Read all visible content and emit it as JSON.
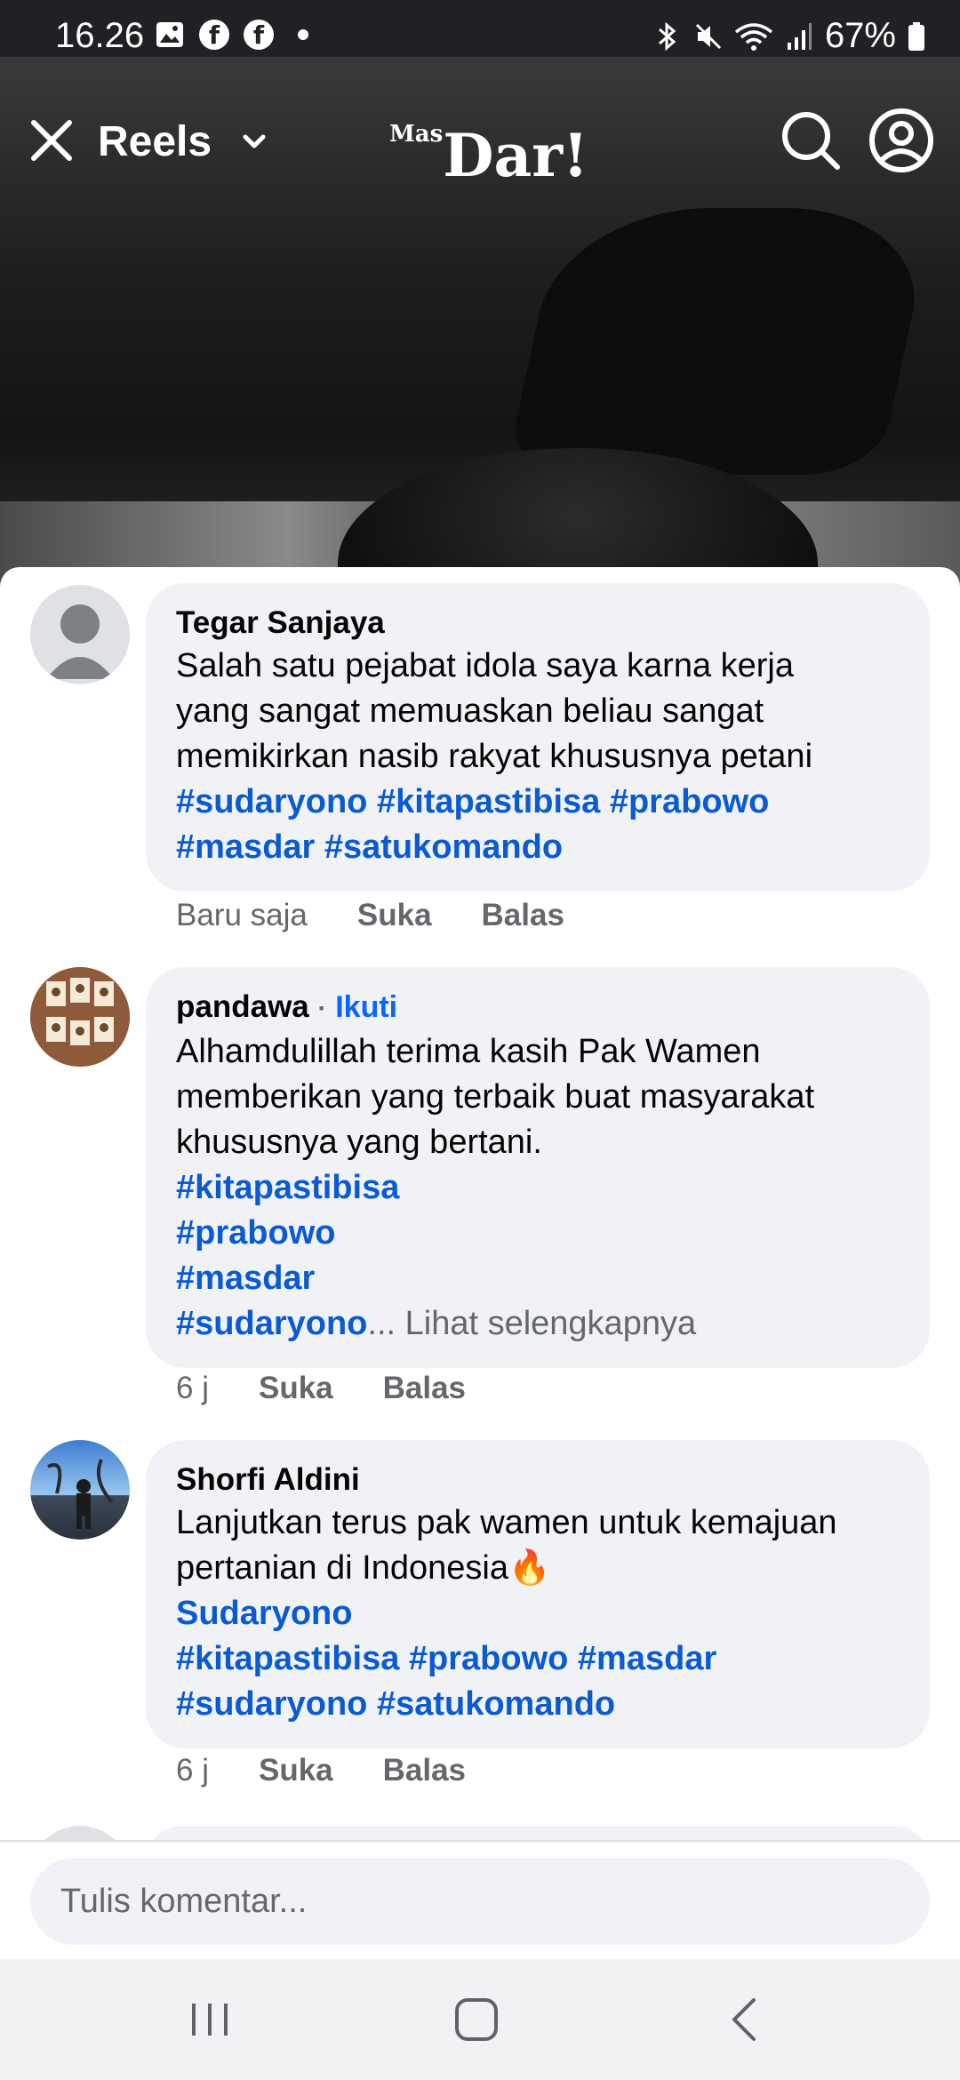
{
  "status_bar": {
    "time": "16.26",
    "battery": "67%",
    "left_icons": [
      "image-icon",
      "facebook-icon",
      "facebook-icon",
      "dot-icon"
    ],
    "right_icons": [
      "bluetooth-icon",
      "mute-icon",
      "wifi-icon",
      "signal-icon",
      "battery-icon"
    ]
  },
  "header": {
    "title": "Reels",
    "brand_prefix": "Mas",
    "brand_main": "Dar!"
  },
  "comments": [
    {
      "name": "Tegar Sanjaya",
      "lines": [
        [
          {
            "t": "Salah satu pejabat idola saya karna kerja"
          }
        ],
        [
          {
            "t": "yang sangat memuaskan beliau sangat"
          }
        ],
        [
          {
            "t": "memikirkan nasib rakyat khususnya petani"
          }
        ],
        [
          {
            "t": "#sudaryono #kitapastibisa #prabowo",
            "tag": true
          }
        ],
        [
          {
            "t": "#masdar #satukomando",
            "tag": true
          }
        ]
      ],
      "time": "Baru saja",
      "like": "Suka",
      "reply": "Balas"
    },
    {
      "name": "pandawa",
      "follow": "Ikuti",
      "lines": [
        [
          {
            "t": "Alhamdulillah terima kasih Pak Wamen"
          }
        ],
        [
          {
            "t": "memberikan yang terbaik buat masyarakat"
          }
        ],
        [
          {
            "t": "khususnya yang bertani."
          }
        ],
        [
          {
            "t": "#kitapastibisa",
            "tag": true
          }
        ],
        [
          {
            "t": "#prabowo",
            "tag": true
          }
        ],
        [
          {
            "t": "#masdar",
            "tag": true
          }
        ],
        [
          {
            "t": "#sudaryono",
            "tag": true
          },
          {
            "t": "... Lihat selengkapnya",
            "more": true
          }
        ]
      ],
      "time": "6 j",
      "like": "Suka",
      "reply": "Balas"
    },
    {
      "name": "Shorfi Aldini",
      "lines": [
        [
          {
            "t": "Lanjutkan terus pak wamen untuk kemajuan"
          }
        ],
        [
          {
            "t": "pertanian di Indonesia🔥"
          }
        ],
        [
          {
            "t": "Sudaryono",
            "tag": true
          }
        ],
        [
          {
            "t": "#kitapastibisa #prabowo #masdar",
            "tag": true
          }
        ],
        [
          {
            "t": "#sudaryono #satukomando",
            "tag": true
          }
        ]
      ],
      "time": "6 j",
      "like": "Suka",
      "reply": "Balas"
    }
  ],
  "comment_input": {
    "placeholder": "Tulis komentar..."
  },
  "nav": [
    "recent-apps-icon",
    "home-icon",
    "back-icon"
  ]
}
